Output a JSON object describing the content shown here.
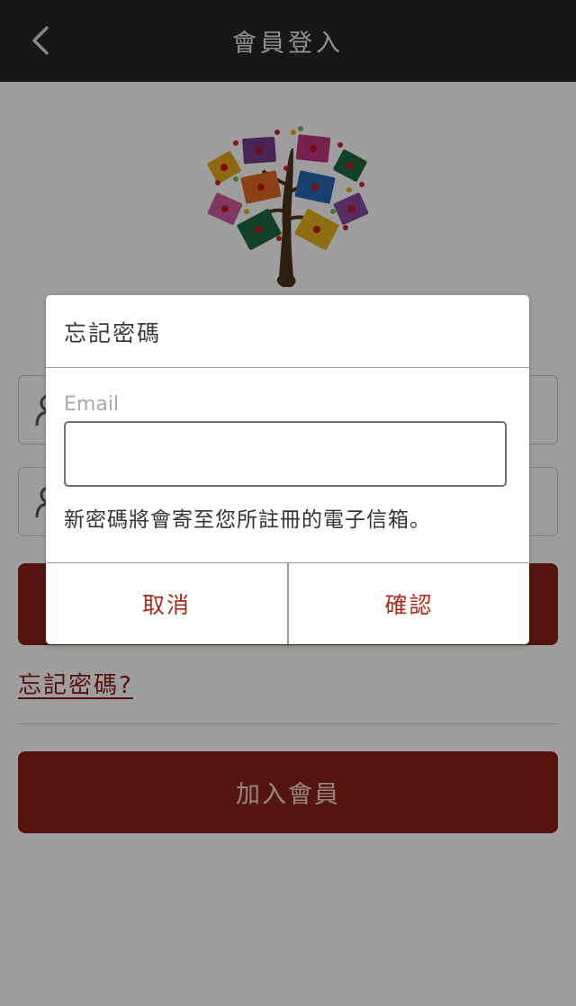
{
  "header": {
    "title": "會員登入",
    "back_icon": "chevron-left-icon"
  },
  "page": {
    "logo": "tree-of-envelopes-logo",
    "account_field_icon": "user-icon",
    "password_field_icon": "user-icon",
    "forgot_link": "忘記密碼?",
    "register_button": "加入會員"
  },
  "dialog": {
    "title": "忘記密碼",
    "email_label": "Email",
    "email_value": "",
    "email_placeholder": "",
    "hint": "新密碼將會寄至您所註冊的電子信箱。",
    "cancel_label": "取消",
    "confirm_label": "確認"
  },
  "colors": {
    "header_bg": "#262626",
    "brand_red": "#8a2318",
    "dialog_button_text": "#b02a1a",
    "overlay": "rgba(0,0,0,0.38)"
  }
}
